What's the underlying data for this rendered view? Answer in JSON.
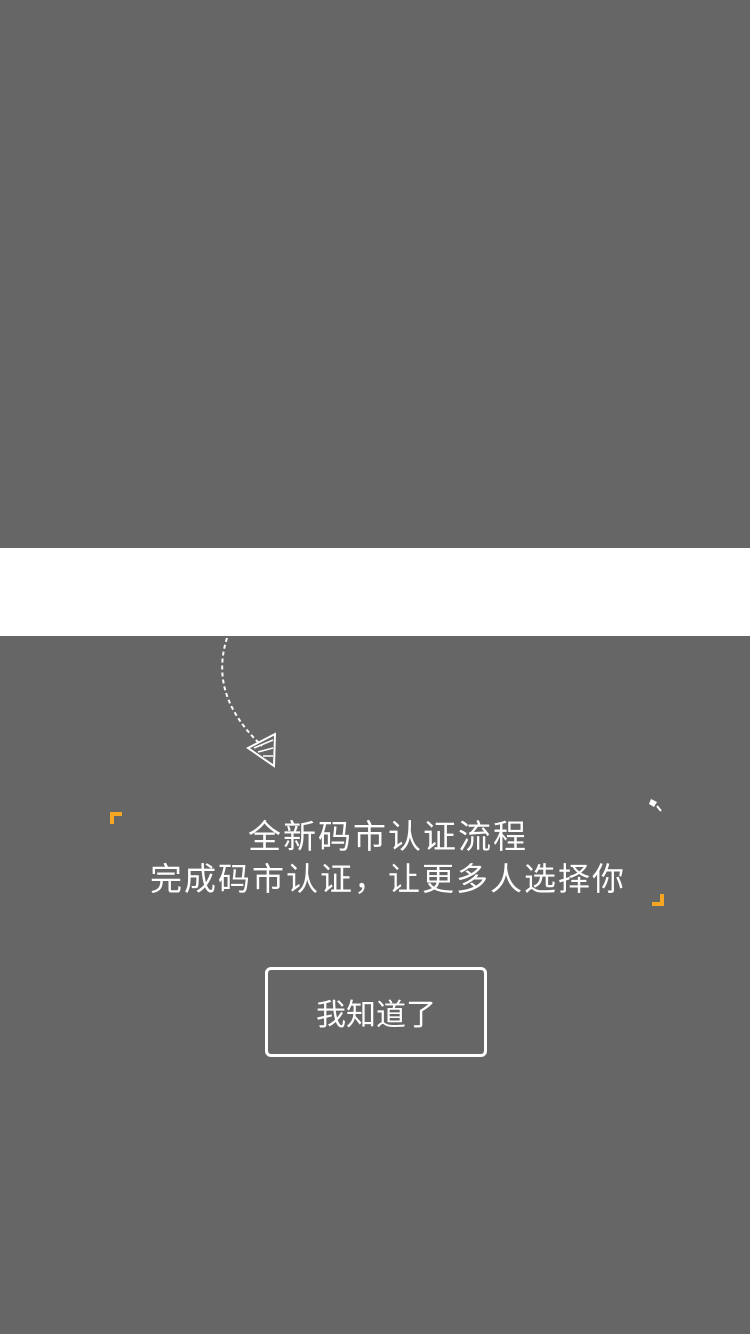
{
  "guide": {
    "title": "全新码市认证流程",
    "subtitle": "完成码市认证，让更多人选择你",
    "confirm_label": "我知道了"
  },
  "colors": {
    "overlay": "#666666",
    "highlight": "#ffffff",
    "accent": "#f5a623",
    "text": "#ffffff"
  },
  "icons": {
    "arrow": "dashed-curved-arrow-icon",
    "bracket_open": "corner-bracket-open-icon",
    "bracket_close": "corner-bracket-close-icon",
    "sparkle": "sparkle-icon"
  }
}
